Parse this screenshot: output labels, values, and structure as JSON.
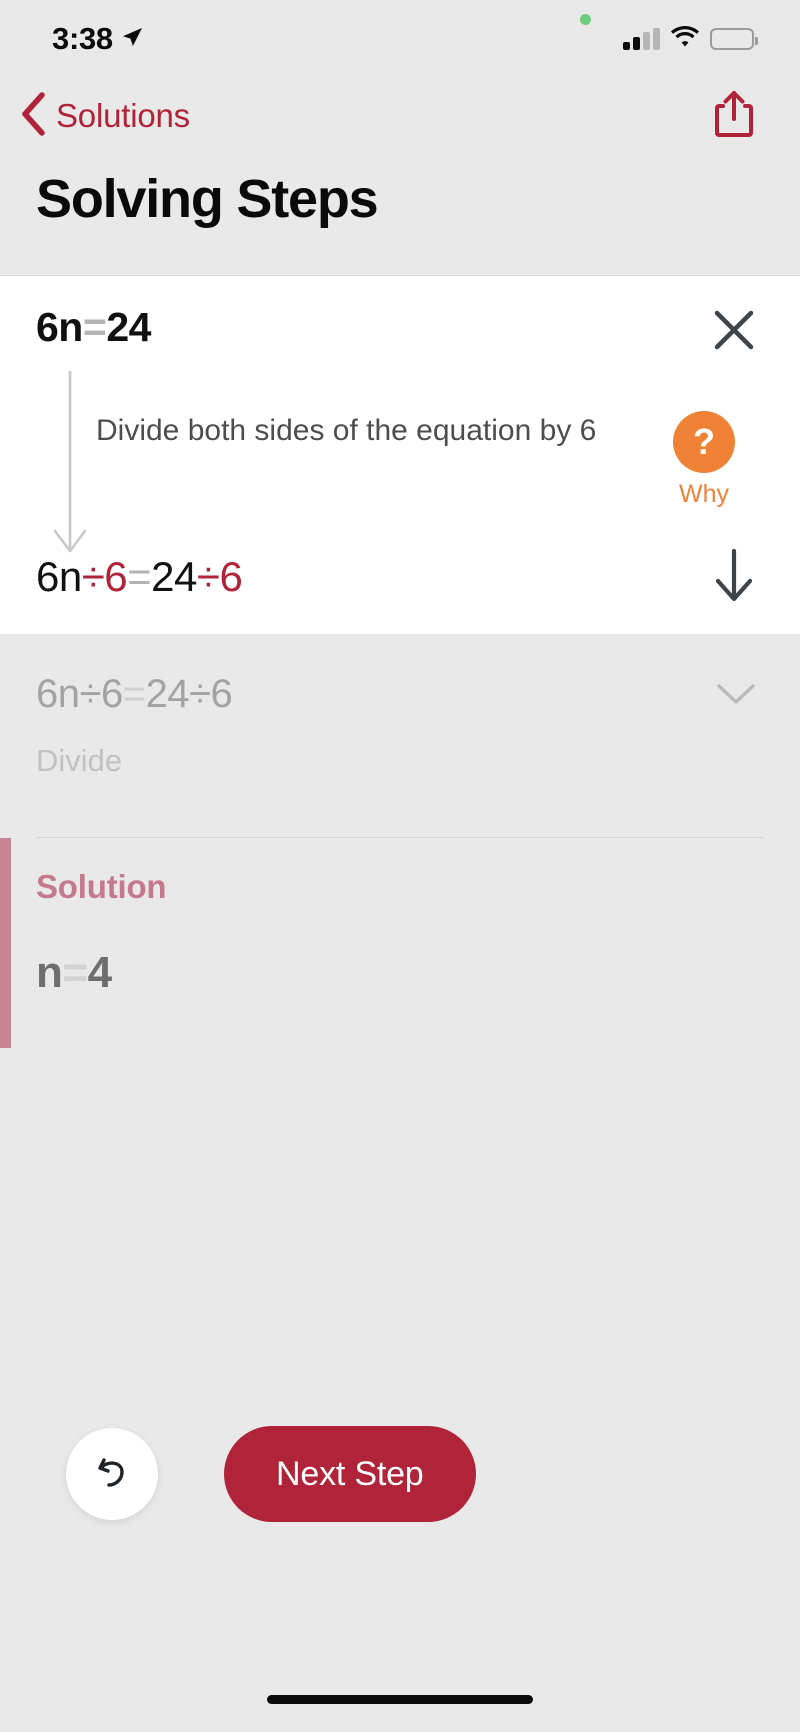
{
  "status_bar": {
    "time": "3:38",
    "location_icon": "location-arrow-icon",
    "recording_dot": "green-recording-dot",
    "cellular_icon": "cellular-signal-icon",
    "wifi_icon": "wifi-icon",
    "battery_icon": "battery-icon"
  },
  "nav": {
    "back_label": "Solutions",
    "back_icon": "chevron-left-icon",
    "share_icon": "share-icon",
    "accent_color": "#b02338"
  },
  "header": {
    "title": "Solving Steps"
  },
  "active_step": {
    "equation_top": {
      "parts": [
        {
          "text": "6n",
          "style": "black"
        },
        {
          "text": "=",
          "style": "equals"
        },
        {
          "text": "24",
          "style": "black"
        }
      ],
      "plain": "6n=24"
    },
    "close_icon": "close-icon",
    "explanation": "Divide both sides of the equation by 6",
    "why": {
      "glyph": "?",
      "label": "Why",
      "color": "#ef8235",
      "icon": "question-mark-icon"
    },
    "equation_result": {
      "parts": [
        {
          "text": "6n",
          "style": "black"
        },
        {
          "text": "÷",
          "style": "red"
        },
        {
          "text": "6",
          "style": "red"
        },
        {
          "text": "=",
          "style": "equals"
        },
        {
          "text": "24",
          "style": "black"
        },
        {
          "text": "÷",
          "style": "red"
        },
        {
          "text": "6",
          "style": "red"
        }
      ],
      "plain": "6n÷6=24÷6"
    },
    "down_icon": "arrow-down-icon",
    "flow_arrow_icon": "flow-arrow-down-icon"
  },
  "collapsed_step": {
    "equation": "6n÷6=24÷6",
    "equation_parts": [
      {
        "text": "6n",
        "style": "dim"
      },
      {
        "text": "÷",
        "style": "dim"
      },
      {
        "text": "6",
        "style": "dim"
      },
      {
        "text": "=",
        "style": "equals"
      },
      {
        "text": "24",
        "style": "dim"
      },
      {
        "text": "÷",
        "style": "dim"
      },
      {
        "text": "6",
        "style": "dim"
      }
    ],
    "label": "Divide",
    "expand_icon": "chevron-down-icon"
  },
  "solution": {
    "label": "Solution",
    "accent_color": "#c5798c",
    "equation_parts": [
      {
        "text": "n",
        "style": "gray"
      },
      {
        "text": "=",
        "style": "equals"
      },
      {
        "text": "4",
        "style": "gray"
      }
    ],
    "plain": "n=4"
  },
  "actions": {
    "undo_icon": "undo-icon",
    "next_label": "Next Step",
    "next_color": "#b02338"
  }
}
